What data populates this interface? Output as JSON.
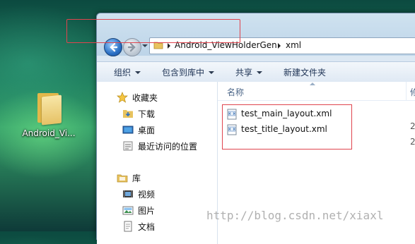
{
  "desktop": {
    "icon_label": "Android_Vi..."
  },
  "window": {
    "breadcrumbs": [
      "Android_ViewHolderGen",
      "xml"
    ],
    "toolbar": [
      {
        "label": "组织"
      },
      {
        "label": "包含到库中"
      },
      {
        "label": "共享"
      },
      {
        "label": "新建文件夹"
      }
    ],
    "nav": {
      "favorites": "收藏夹",
      "favorites_items": [
        "下载",
        "桌面",
        "最近访问的位置"
      ],
      "libraries": "库",
      "library_items": [
        "视频",
        "图片",
        "文档"
      ]
    },
    "columns": {
      "name": "名称",
      "next_cut": "修"
    },
    "files": [
      {
        "name": "test_main_layout.xml",
        "date": "2"
      },
      {
        "name": "test_title_layout.xml",
        "date": "2"
      }
    ]
  },
  "watermark": "http://blog.csdn.net/xiaxl",
  "colors": {
    "highlight": "#e0444e",
    "nav_back": "#2a6fc4"
  }
}
